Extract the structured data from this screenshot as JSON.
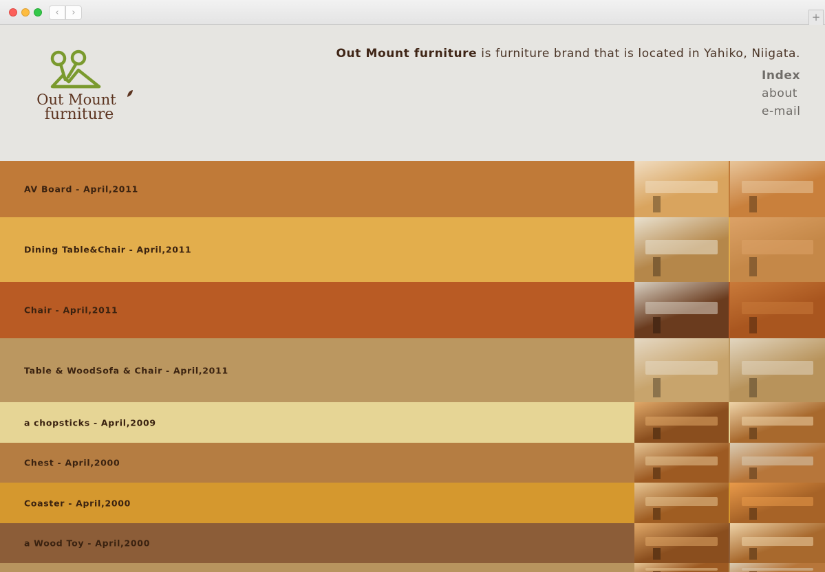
{
  "browser": {
    "back_glyph": "‹",
    "forward_glyph": "›",
    "new_tab_glyph": "+"
  },
  "logo": {
    "line1": "Out Mount",
    "line2": "furniture",
    "mark_color": "#7a9a2e",
    "text_color": "#5c3420"
  },
  "header": {
    "tagline_brand": "Out Mount furniture",
    "tagline_rest": " is furniture brand that is located in Yahiko, Niigata."
  },
  "nav": {
    "items": [
      {
        "label": "Index",
        "active": true
      },
      {
        "label": "about",
        "active": false
      },
      {
        "label": "e-mail",
        "active": false
      }
    ]
  },
  "works": [
    {
      "label": "AV Board - April,2011",
      "color": "#c07a38",
      "thumbs": [
        {
          "bg": "#d9a45e",
          "accent": "#f0dcc0"
        },
        {
          "bg": "#c9803c",
          "accent": "#e8c59a"
        }
      ]
    },
    {
      "label": "Dining Table&Chair - April,2011",
      "color": "#e3ae4c",
      "thumbs": [
        {
          "bg": "#b5874a",
          "accent": "#e9e1cf"
        },
        {
          "bg": "#c58848",
          "accent": "#dca267"
        }
      ]
    },
    {
      "label": "Chair - April,2011",
      "color": "#b95b24",
      "thumbs": [
        {
          "bg": "#6a3b1e",
          "accent": "#d8d0c2"
        },
        {
          "bg": "#a9561f",
          "accent": "#c97a3a"
        }
      ]
    },
    {
      "label": "Table & WoodSofa & Chair - April,2011",
      "color": "#bb9760",
      "thumbs": [
        {
          "bg": "#c8a46c",
          "accent": "#e5d8c3"
        },
        {
          "bg": "#b8935b",
          "accent": "#e2d6c0"
        }
      ]
    },
    {
      "label": "a chopsticks - April,2009",
      "color": "#e6d595",
      "thumbs": [
        {
          "bg": "#8a4e1e",
          "accent": "#e0a868"
        },
        {
          "bg": "#a8692d",
          "accent": "#eed3a8"
        }
      ]
    },
    {
      "label": "Chest - April,2000",
      "color": "#b57d42",
      "thumbs": [
        {
          "bg": "#9d5a22",
          "accent": "#e5c493"
        },
        {
          "bg": "#b7763a",
          "accent": "#d9cbb3"
        }
      ]
    },
    {
      "label": "Coaster - April,2000",
      "color": "#d5982e",
      "thumbs": [
        {
          "bg": "#9f5d22",
          "accent": "#e7c592"
        },
        {
          "bg": "#a76327",
          "accent": "#e99a4a"
        }
      ]
    },
    {
      "label": "a Wood Toy - April,2000",
      "color": "#8c5d38",
      "thumbs": [
        {
          "bg": "#8a4e1e",
          "accent": "#e0a868"
        },
        {
          "bg": "#a8692d",
          "accent": "#eed3a8"
        }
      ]
    },
    {
      "label": "",
      "color": "#b8945e",
      "thumbs": [
        {
          "bg": "#9d5a22",
          "accent": "#e5c493"
        },
        {
          "bg": "#b7763a",
          "accent": "#d9cbb3"
        }
      ]
    }
  ]
}
